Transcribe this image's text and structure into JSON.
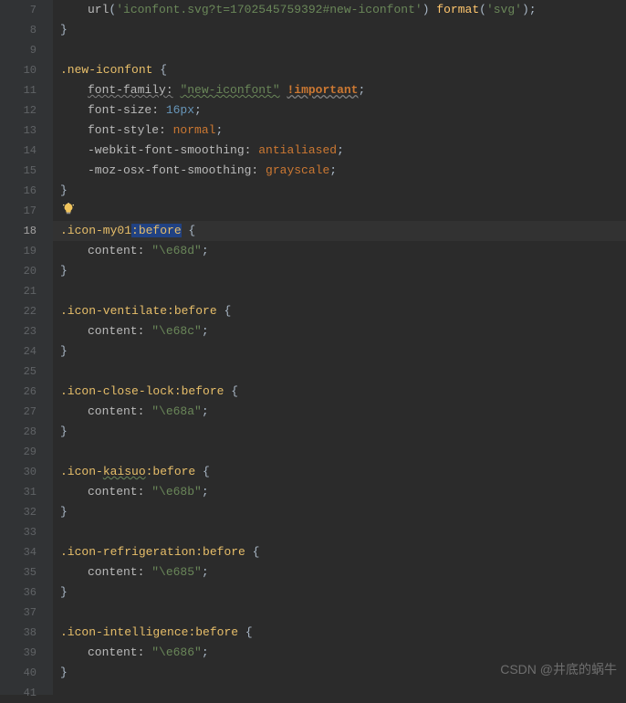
{
  "gutter": {
    "start": 7,
    "end": 41,
    "current": 18
  },
  "code": {
    "l7_url": "url",
    "l7_str1": "'iconfont.svg?t=1702545759392#new-iconfont'",
    "l7_format": "format",
    "l7_str2": "'svg'",
    "l8_brace": "}",
    "l10_sel": ".new-iconfont",
    "l10_brace": " {",
    "l11_prop": "font-family:",
    "l11_val": "\"new-iconfont\"",
    "l11_imp": "!important",
    "l12_prop": "font-size: ",
    "l12_val": "16px",
    "l13_prop": "font-style: ",
    "l13_val": "normal",
    "l14_prop": "-webkit-font-smoothing: ",
    "l14_val": "antialiased",
    "l15_prop": "-moz-osx-font-smoothing: ",
    "l15_val": "grayscale",
    "l16_brace": "}",
    "l18_sel": ".icon-my01",
    "l18_pseudo": ":before",
    "l18_brace": " {",
    "l19_prop": "content: ",
    "l19_val": "\"\\e68d\"",
    "l20_brace": "}",
    "l22_sel": ".icon-ventilate",
    "l22_pseudo": ":before",
    "l22_brace": " {",
    "l23_prop": "content: ",
    "l23_val": "\"\\e68c\"",
    "l24_brace": "}",
    "l26_sel": ".icon-close-lock",
    "l26_pseudo": ":before",
    "l26_brace": " {",
    "l27_prop": "content: ",
    "l27_val": "\"\\e68a\"",
    "l28_brace": "}",
    "l30_sel": ".icon-",
    "l30_sel2": "kaisuo",
    "l30_pseudo": ":before",
    "l30_brace": " {",
    "l31_prop": "content: ",
    "l31_val": "\"\\e68b\"",
    "l32_brace": "}",
    "l34_sel": ".icon-refrigeration",
    "l34_pseudo": ":before",
    "l34_brace": " {",
    "l35_prop": "content: ",
    "l35_val": "\"\\e685\"",
    "l36_brace": "}",
    "l38_sel": ".icon-intelligence",
    "l38_pseudo": ":before",
    "l38_brace": " {",
    "l39_prop": "content: ",
    "l39_val": "\"\\e686\"",
    "l40_brace": "}"
  },
  "watermark": "CSDN @井底的蜗牛",
  "semi": ";",
  "lp": "(",
  "rp": ")"
}
